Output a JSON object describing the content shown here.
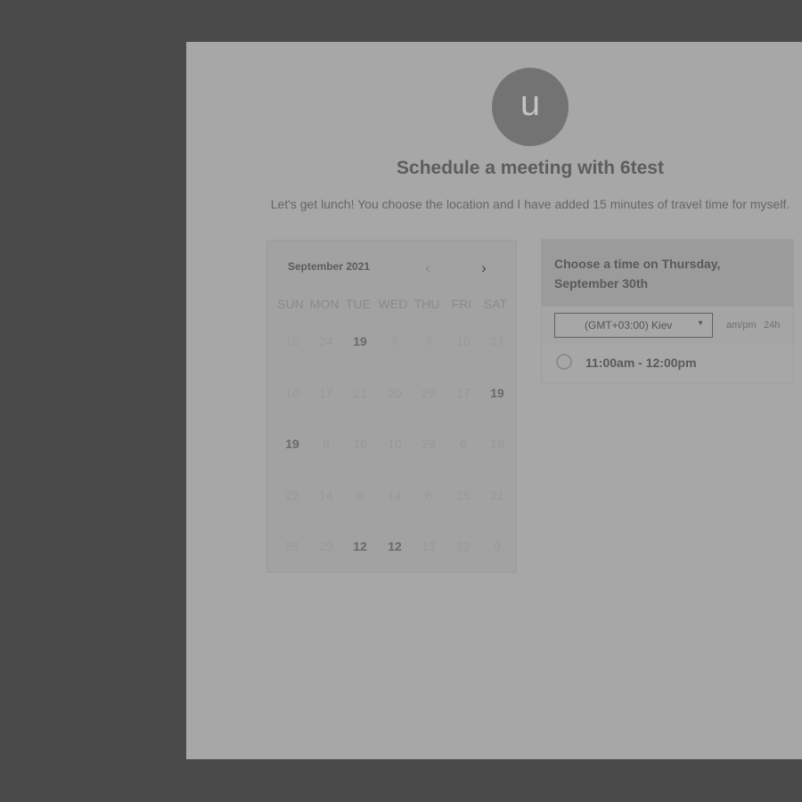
{
  "header": {
    "avatar_letter": "u",
    "title": "Schedule a meeting with 6test",
    "subtitle": "Let's get lunch! You choose the location and I have added 15 minutes of travel time for myself."
  },
  "calendar": {
    "month_label": "September 2021",
    "prev_icon": "chevron-left-icon",
    "next_icon": "chevron-right-icon",
    "weekdays": [
      "SUN",
      "MON",
      "TUE",
      "WED",
      "THU",
      "FRI",
      "SAT"
    ],
    "weeks": [
      [
        {
          "d": "10"
        },
        {
          "d": "24"
        },
        {
          "d": "19",
          "bold": true
        },
        {
          "d": "7"
        },
        {
          "d": "7"
        },
        {
          "d": "10"
        },
        {
          "d": "27"
        }
      ],
      [
        {
          "d": "10"
        },
        {
          "d": "17"
        },
        {
          "d": "21"
        },
        {
          "d": "20"
        },
        {
          "d": "29"
        },
        {
          "d": "17"
        },
        {
          "d": "19",
          "bold": true
        }
      ],
      [
        {
          "d": "19",
          "bold": true
        },
        {
          "d": "8"
        },
        {
          "d": "16"
        },
        {
          "d": "10"
        },
        {
          "d": "29"
        },
        {
          "d": "6"
        },
        {
          "d": "16"
        }
      ],
      [
        {
          "d": "22"
        },
        {
          "d": "14"
        },
        {
          "d": "9"
        },
        {
          "d": "14"
        },
        {
          "d": "6"
        },
        {
          "d": "25"
        },
        {
          "d": "21"
        }
      ],
      [
        {
          "d": "26"
        },
        {
          "d": "29"
        },
        {
          "d": "12",
          "bold": true
        },
        {
          "d": "12",
          "bold": true
        },
        {
          "d": "13"
        },
        {
          "d": "22"
        },
        {
          "d": "9"
        }
      ]
    ]
  },
  "times": {
    "heading": "Choose a time on Thursday, September 30th",
    "timezone_value": "(GMT+03:00) Kiev",
    "format_ampm": "am/pm",
    "format_24h": "24h",
    "slots": [
      "11:00am - 12:00pm"
    ]
  },
  "colors": {
    "backdrop": "#4a4a4a",
    "panel": "#a7a7a7",
    "avatar": "#737373"
  }
}
